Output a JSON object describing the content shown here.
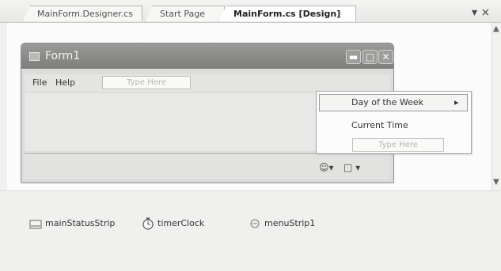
{
  "tabs": [
    {
      "label": "MainForm.Designer.cs",
      "active": false
    },
    {
      "label": "Start Page",
      "active": false
    },
    {
      "label": "MainForm.cs [Design]",
      "active": true
    }
  ],
  "tab_close_glyph": "▾ ×",
  "form": {
    "title": "Form1",
    "menu": {
      "file": "File",
      "help": "Help",
      "type_here": "Type Here"
    },
    "status_strip": {
      "smiley_icon": "smiley-icon",
      "add_item_icon": "split-button-icon"
    }
  },
  "dropdown": {
    "items": [
      "Day of the Week",
      "Current Time"
    ],
    "submenu_arrow": "▸",
    "type_here": "Type Here"
  },
  "components": [
    {
      "name": "mainStatusStrip",
      "icon": "status-strip-icon"
    },
    {
      "name": "timerClock",
      "icon": "timer-icon"
    },
    {
      "name": "menuStrip1",
      "icon": "menu-strip-icon"
    }
  ],
  "colors": {
    "accent_title": "#8c8c8a",
    "selection_border": "#9b9b99"
  }
}
